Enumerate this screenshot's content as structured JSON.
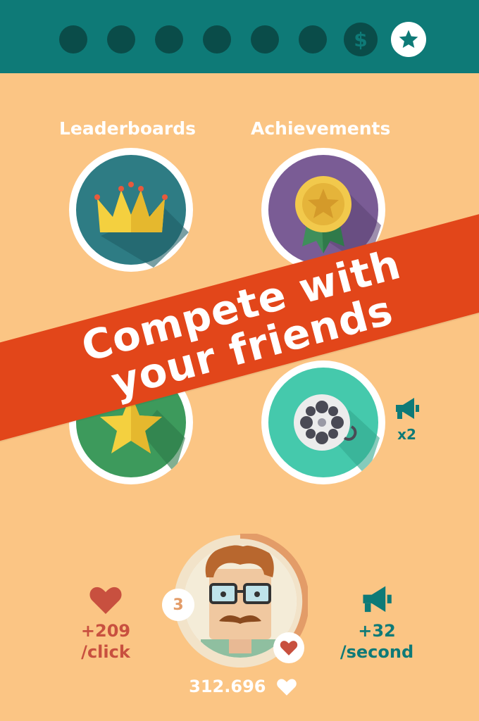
{
  "header": {
    "page_dots": 6,
    "currency_symbol": "$",
    "active_tab": "star"
  },
  "menu": {
    "leaderboards_label": "Leaderboards",
    "achievements_label": "Achievements"
  },
  "banner": {
    "line1": "Compete with",
    "line2": "your friends"
  },
  "video_bonus": {
    "multiplier": "x2"
  },
  "stats": {
    "per_click_value": "+209",
    "per_click_unit": "/click",
    "per_second_value": "+32",
    "per_second_unit": "/second",
    "level": "3",
    "total_hearts": "312.696"
  },
  "colors": {
    "background": "#FBC584",
    "header": "#0E7A77",
    "banner": "#E2461A",
    "heart": "#C8503F"
  }
}
